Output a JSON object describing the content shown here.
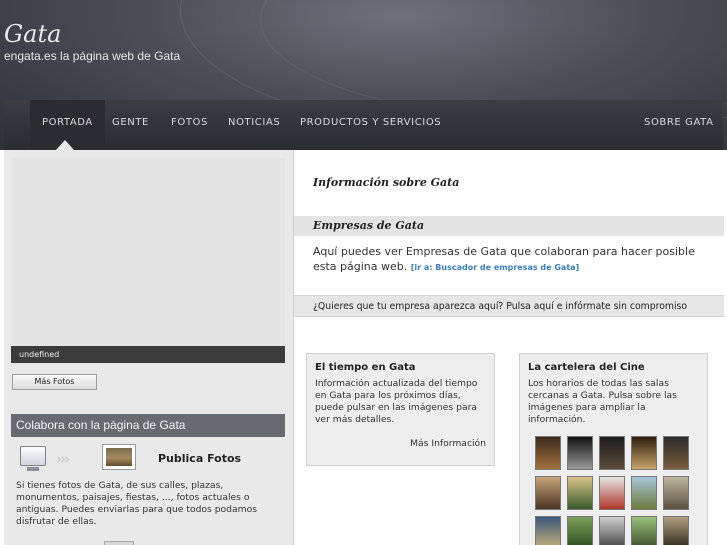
{
  "header": {
    "site_title": "Gata",
    "tagline": "engata.es la página web de Gata"
  },
  "nav": {
    "items": [
      {
        "label": "PORTADA",
        "active": true
      },
      {
        "label": "GENTE",
        "active": false
      },
      {
        "label": "FOTOS",
        "active": false
      },
      {
        "label": "NOTICIAS",
        "active": false
      },
      {
        "label": "PRODUCTOS Y SERVICIOS",
        "active": false
      },
      {
        "label": "SOBRE GATA",
        "active": false
      }
    ]
  },
  "left": {
    "gallery_caption": "undefined",
    "mas_fotos_button": "Más Fotos",
    "colabora_title": "Colabora con la página de Gata",
    "publica_title": "Publica Fotos",
    "publica_text": "Si tienes fotos de Gata, de sus calles, plazas, monumentos, paisajes, fiestas, ..., fotos actuales o antiguas. Puedes enviarlas para que todos podamos disfrutar de ellas."
  },
  "right": {
    "info_title": "Información sobre Gata",
    "empresas_title": "Empresas de Gata",
    "empresas_text": "Aquí puedes ver Empresas de Gata que colaboran para hacer posible esta página web.",
    "empresas_link": "[ir a: Buscador de empresas de Gata]",
    "quieres_text": "¿Quieres que tu empresa aparezca aquí? Pulsa aquí e infórmate sin compromiso",
    "tiempo": {
      "title": "El tiempo en Gata",
      "text": "Información actualizada del tiempo en Gata para los próximos días, puede pulsar en las imágenes para ver más detalles.",
      "link": "Más Información"
    },
    "cine": {
      "title": "La cartelera del Cine",
      "text": "Los horarios de todas las salas cercanas a Gata. Pulsa sobre las imágenes para ampliar la información."
    }
  },
  "colors": {
    "header_bg": "#4a4f56",
    "nav_bg": "#333639",
    "left_bg": "#e9e9e9",
    "colabora_bar": "#676b70",
    "link_blue": "#3b7fc4"
  }
}
